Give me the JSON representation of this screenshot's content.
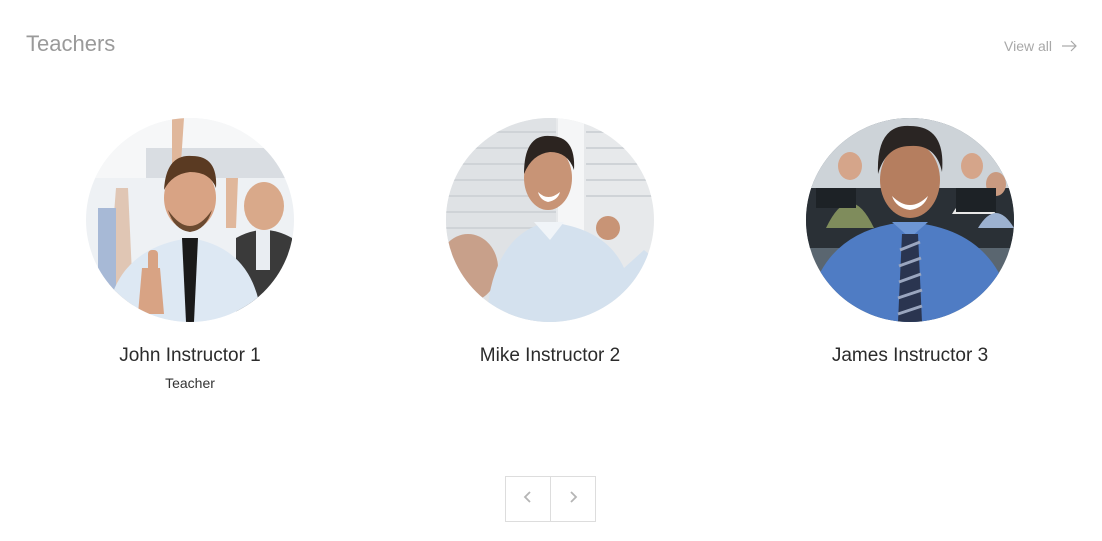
{
  "section": {
    "title": "Teachers",
    "view_all_label": "View all",
    "view_all_icon": "arrow-right-icon"
  },
  "teachers": [
    {
      "name": "John Instructor 1",
      "role": "Teacher",
      "photo": "teacher-photo-thumbs-up"
    },
    {
      "name": "Mike Instructor 2",
      "role": "",
      "photo": "teacher-photo-presenting"
    },
    {
      "name": "James Instructor 3",
      "role": "",
      "photo": "teacher-photo-classroom"
    }
  ],
  "pager": {
    "prev_icon": "chevron-left-icon",
    "next_icon": "chevron-right-icon"
  },
  "colors": {
    "title": "#9a9a9a",
    "link": "#a8a8a8",
    "name": "#2b2b2b",
    "border": "#dddddd"
  }
}
